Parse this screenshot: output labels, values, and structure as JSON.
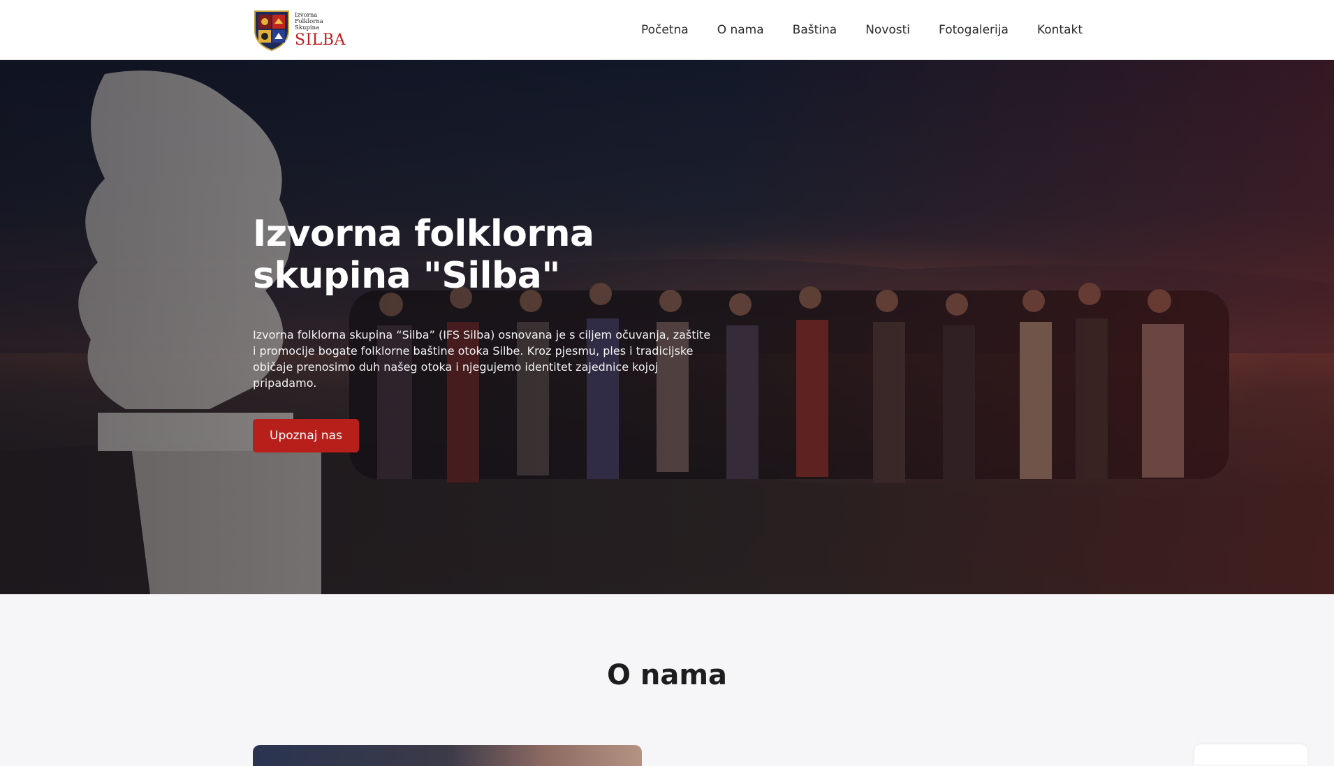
{
  "header": {
    "logo": {
      "lines": [
        "Izvorna",
        "Folklorna",
        "Skupina"
      ],
      "name": "SILBA"
    },
    "nav": [
      {
        "label": "Početna"
      },
      {
        "label": "O nama"
      },
      {
        "label": "Baština"
      },
      {
        "label": "Novosti"
      },
      {
        "label": "Fotogalerija"
      },
      {
        "label": "Kontakt"
      }
    ]
  },
  "hero": {
    "title": "Izvorna folklorna skupina \"Silba\"",
    "text": "Izvorna folklorna skupina “Silba” (IFS Silba) osnovana je s ciljem očuvanja, zaštite i promocije bogate folklorne baštine otoka Silbe. Kroz pjesmu, ples i tradicijske običaje prenosimo duh našeg otoka i njegujemo identitet zajednice kojoj pripadamo.",
    "button_label": "Upoznaj nas"
  },
  "about": {
    "title": "O nama"
  },
  "colors": {
    "accent": "#b71f1a",
    "logo_red": "#c21d1d",
    "header_bg": "#ffffff",
    "page_bg": "#f6f6f8"
  }
}
